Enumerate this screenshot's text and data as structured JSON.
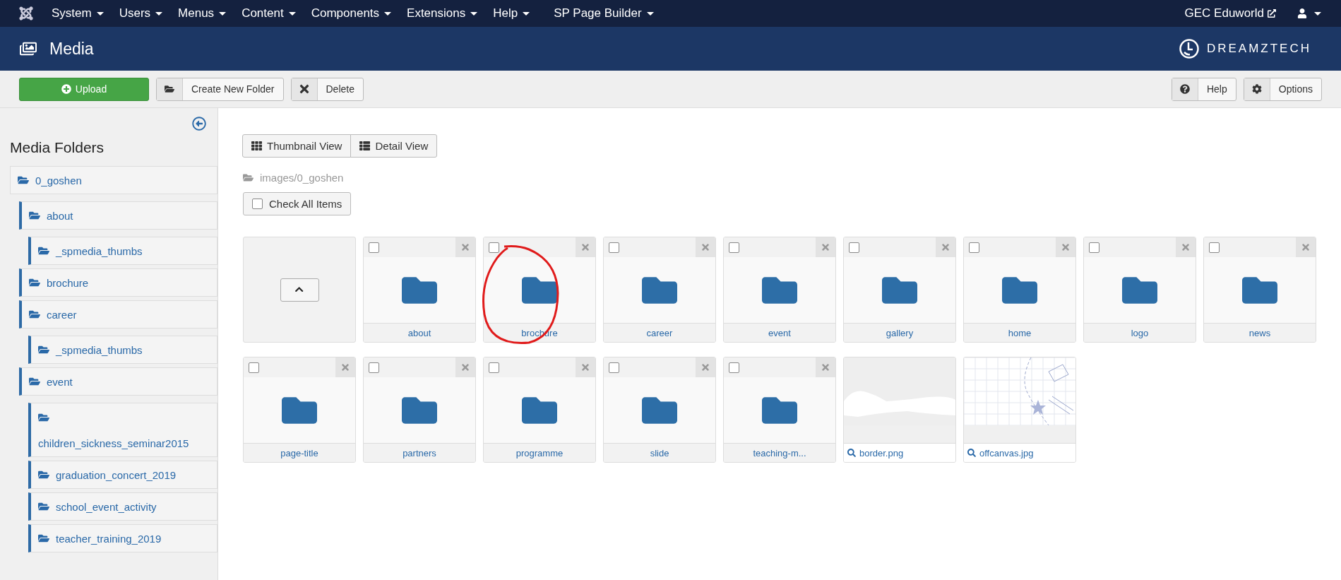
{
  "top_menu": {
    "items": [
      {
        "label": "System"
      },
      {
        "label": "Users"
      },
      {
        "label": "Menus"
      },
      {
        "label": "Content"
      },
      {
        "label": "Components"
      },
      {
        "label": "Extensions"
      },
      {
        "label": "Help"
      },
      {
        "label": "SP Page Builder"
      }
    ],
    "site_link": "GEC Eduworld"
  },
  "header": {
    "title": "Media",
    "brand": "DREAMZTECH"
  },
  "toolbar": {
    "left": [
      {
        "label": "Upload",
        "kind": "upload"
      },
      {
        "label": "Create New Folder",
        "kind": "folder"
      },
      {
        "label": "Delete",
        "kind": "delete"
      }
    ],
    "right": [
      {
        "label": "Help",
        "kind": "help"
      },
      {
        "label": "Options",
        "kind": "options"
      }
    ]
  },
  "sidebar": {
    "title": "Media Folders",
    "tree": [
      {
        "label": "0_goshen",
        "children": [
          {
            "label": "about",
            "children": [
              {
                "label": "_spmedia_thumbs"
              }
            ]
          },
          {
            "label": "brochure"
          },
          {
            "label": "career",
            "children": [
              {
                "label": "_spmedia_thumbs"
              }
            ]
          },
          {
            "label": "event",
            "children": [
              {
                "label": "children_sickness_seminar2015",
                "wrapped": true
              },
              {
                "label": "graduation_concert_2019"
              },
              {
                "label": "school_event_activity"
              },
              {
                "label": "teacher_training_2019"
              }
            ]
          }
        ]
      }
    ]
  },
  "view_toggle": [
    {
      "label": "Thumbnail View",
      "kind": "grid"
    },
    {
      "label": "Detail View",
      "kind": "list"
    }
  ],
  "path": "images/0_goshen",
  "check_all": {
    "label": "Check All Items",
    "checked": false
  },
  "items": [
    {
      "kind": "up"
    },
    {
      "kind": "folder",
      "name": "about",
      "checked": false
    },
    {
      "kind": "folder",
      "name": "brochure",
      "checked": false,
      "circled": true
    },
    {
      "kind": "folder",
      "name": "career",
      "checked": false
    },
    {
      "kind": "folder",
      "name": "event",
      "checked": false
    },
    {
      "kind": "folder",
      "name": "gallery",
      "checked": false
    },
    {
      "kind": "folder",
      "name": "home",
      "checked": false
    },
    {
      "kind": "folder",
      "name": "logo",
      "checked": false
    },
    {
      "kind": "folder",
      "name": "news",
      "checked": false
    },
    {
      "kind": "folder",
      "name": "page-title",
      "checked": false
    },
    {
      "kind": "folder",
      "name": "partners",
      "checked": false
    },
    {
      "kind": "folder",
      "name": "programme",
      "checked": false
    },
    {
      "kind": "folder",
      "name": "slide",
      "checked": false
    },
    {
      "kind": "folder",
      "name": "teaching-m...",
      "checked": false
    },
    {
      "kind": "blob_image",
      "name": "border.png"
    },
    {
      "kind": "sketch_image",
      "name": "offcanvas.jpg"
    }
  ]
}
